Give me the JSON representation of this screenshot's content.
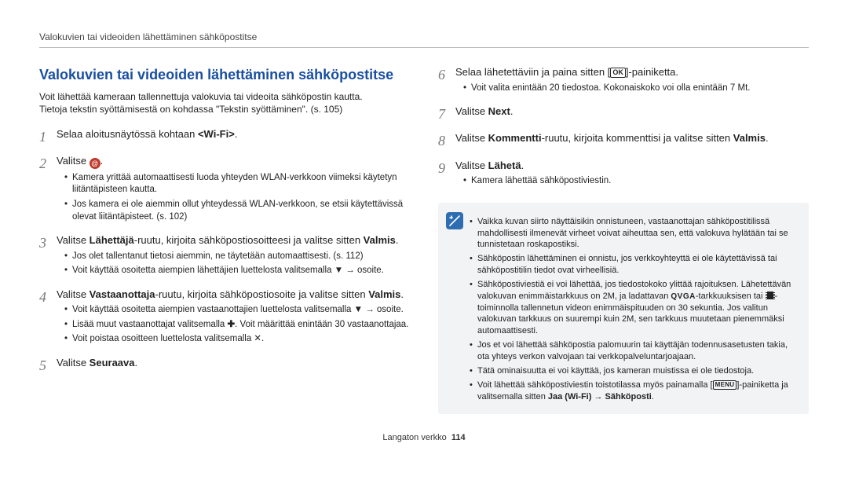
{
  "header": {
    "running_title": "Valokuvien tai videoiden lähettäminen sähköpostitse"
  },
  "left": {
    "title": "Valokuvien tai videoiden lähettäminen sähköpostitse",
    "intro_a": "Voit lähettää kameraan tallennettuja valokuvia tai videoita sähköpostin kautta.",
    "intro_b": "Tietoja tekstin syöttämisestä on kohdassa \"Tekstin syöttäminen\". (s. 105)",
    "step1": {
      "pre": "Selaa aloitusnäytössä kohtaan ",
      "tag": "<Wi-Fi>",
      "post": "."
    },
    "step2": {
      "pre": "Valitse ",
      "post": "."
    },
    "step2_bullets": [
      "Kamera yrittää automaattisesti luoda yhteyden WLAN-verkkoon viimeksi käytetyn liitäntäpisteen kautta.",
      "Jos kamera ei ole aiemmin ollut yhteydessä WLAN-verkkoon, se etsii käytettävissä olevat liitäntäpisteet. (s. 102)"
    ],
    "step3": {
      "a": "Valitse ",
      "b": "Lähettäjä",
      "c": "-ruutu, kirjoita sähköpostiosoitteesi ja valitse sitten ",
      "d": "Valmis",
      "e": "."
    },
    "step3_bullets": [
      "Jos olet tallentanut tietosi aiemmin, ne täytetään automaattisesti. (s. 112)",
      "Voit käyttää osoitetta aiempien lähettäjien luettelosta valitsemalla ▼ → osoite."
    ],
    "step4": {
      "a": "Valitse ",
      "b": "Vastaanottaja",
      "c": "-ruutu, kirjoita sähköpostiosoite ja valitse sitten ",
      "d": "Valmis",
      "e": "."
    },
    "step4_bullets_a": "Voit käyttää osoitetta aiempien vastaanottajien luettelosta valitsemalla ▼ → osoite.",
    "step4_bullets_b_pre": "Lisää muut vastaanottajat valitsemalla ",
    "step4_bullets_b_post": ". Voit määrittää enintään 30 vastaanottajaa.",
    "step4_bullets_c": "Voit poistaa osoitteen luettelosta valitsemalla ✕.",
    "step5": {
      "a": "Valitse ",
      "b": "Seuraava",
      "c": "."
    }
  },
  "right": {
    "step6": {
      "a": "Selaa lähetettäviin ja paina sitten [",
      "ok": "OK",
      "b": "]-painiketta."
    },
    "step6_bullet": "Voit valita enintään 20 tiedostoa. Kokonaiskoko voi olla enintään 7 Mt.",
    "step7": {
      "a": "Valitse ",
      "b": "Next",
      "c": "."
    },
    "step8": {
      "a": "Valitse ",
      "b": "Kommentti",
      "c": "-ruutu, kirjoita kommenttisi ja valitse sitten ",
      "d": "Valmis",
      "e": "."
    },
    "step9": {
      "a": "Valitse ",
      "b": "Lähetä",
      "c": "."
    },
    "step9_bullet": "Kamera lähettää sähköpostiviestin.",
    "note": {
      "n1": "Vaikka kuvan siirto näyttäisikin onnistuneen, vastaanottajan sähköpostitilissä mahdollisesti ilmenevät virheet voivat aiheuttaa sen, että valokuva hylätään tai se tunnistetaan roskapostiksi.",
      "n2": "Sähköpostin lähettäminen ei onnistu, jos verkkoyhteyttä ei ole käytettävissä tai sähköpostitilin tiedot ovat virheellisiä.",
      "n3a": "Sähköpostiviestiä ei voi lähettää, jos tiedostokoko ylittää rajoituksen. Lähetettävän valokuvan enimmäistarkkuus on 2M, ja ladattavan ",
      "n3_qvga": "QVGA",
      "n3b": "-tarkkuuksisen tai ",
      "n3c": "-toiminnolla tallennetun videon enimmäispituuden on 30 sekuntia. Jos valitun valokuvan tarkkuus on suurempi kuin 2M, sen tarkkuus muutetaan pienemmäksi automaattisesti.",
      "n4": "Jos et voi lähettää sähköpostia palomuurin tai käyttäjän todennusasetusten takia, ota yhteys verkon valvojaan tai verkkopalveluntarjoajaan.",
      "n5": "Tätä ominaisuutta ei voi käyttää, jos kameran muistissa ei ole tiedostoja.",
      "n6a": "Voit lähettää sähköpostiviestin toistotilassa myös painamalla [",
      "n6_menu": "MENU",
      "n6b": "]-painiketta ja valitsemalla sitten ",
      "n6c": "Jaa (Wi-Fi)",
      "n6d": " → ",
      "n6e": "Sähköposti",
      "n6f": "."
    }
  },
  "footer": {
    "section": "Langaton verkko",
    "page": "114"
  }
}
